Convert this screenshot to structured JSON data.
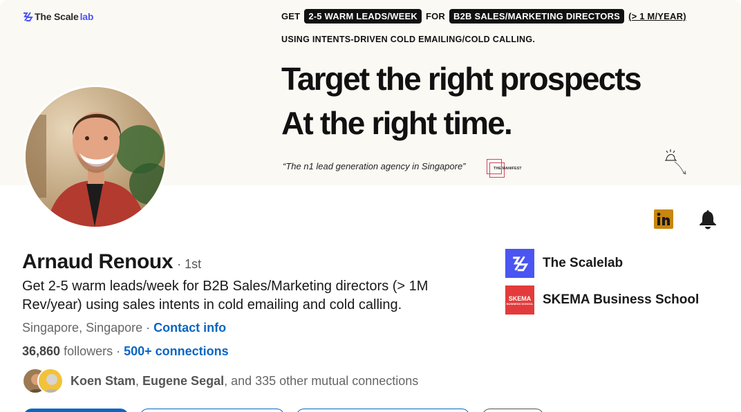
{
  "banner": {
    "brand": {
      "part1": "The Scale",
      "part2": "lab"
    },
    "tag_get": "GET",
    "tag_leads": "2-5 WARM LEADS/WEEK",
    "tag_for": "FOR",
    "tag_directors": "B2B SALES/MARKETING DIRECTORS",
    "tag_revenue": "(> 1 M/YEAR)",
    "subtag": "USING INTENTS-DRIVEN COLD EMAILING/COLD CALLING.",
    "headline_line1": "Target the right prospects",
    "headline_line2": "At the right time.",
    "quote": "“The n1 lead generation agency in Singapore”",
    "manifest_label": "THE MANIFEST"
  },
  "profile": {
    "name": "Arnaud Renoux",
    "degree": "· 1st",
    "headline": "Get 2-5 warm leads/week for B2B Sales/Marketing directors (> 1M Rev/year) using sales intents in cold emailing and cold calling.",
    "location": "Singapore, Singapore",
    "separator": " · ",
    "contact_info": "Contact info",
    "followers_count": "36,860",
    "followers_label": " followers",
    "connections_separator": "  · ",
    "connections": "500+ connections",
    "mutual_name1": "Koen Stam",
    "mutual_sep": ", ",
    "mutual_name2": "Eugene Segal",
    "mutual_rest": ", and 335 other mutual connections"
  },
  "affiliations": [
    {
      "name": "The Scalelab"
    },
    {
      "name": "SKEMA Business School",
      "logo_text": "SKEMA",
      "logo_sub": "BUSINESS SCHOOL"
    }
  ],
  "icons": {
    "linkedin": "in",
    "bell": "bell-icon"
  },
  "colors": {
    "link": "#0a66c2",
    "scalelab_brand": "#4a55f2",
    "skema_red": "#e33b3b",
    "linkedin_badge": "#c8860d"
  }
}
